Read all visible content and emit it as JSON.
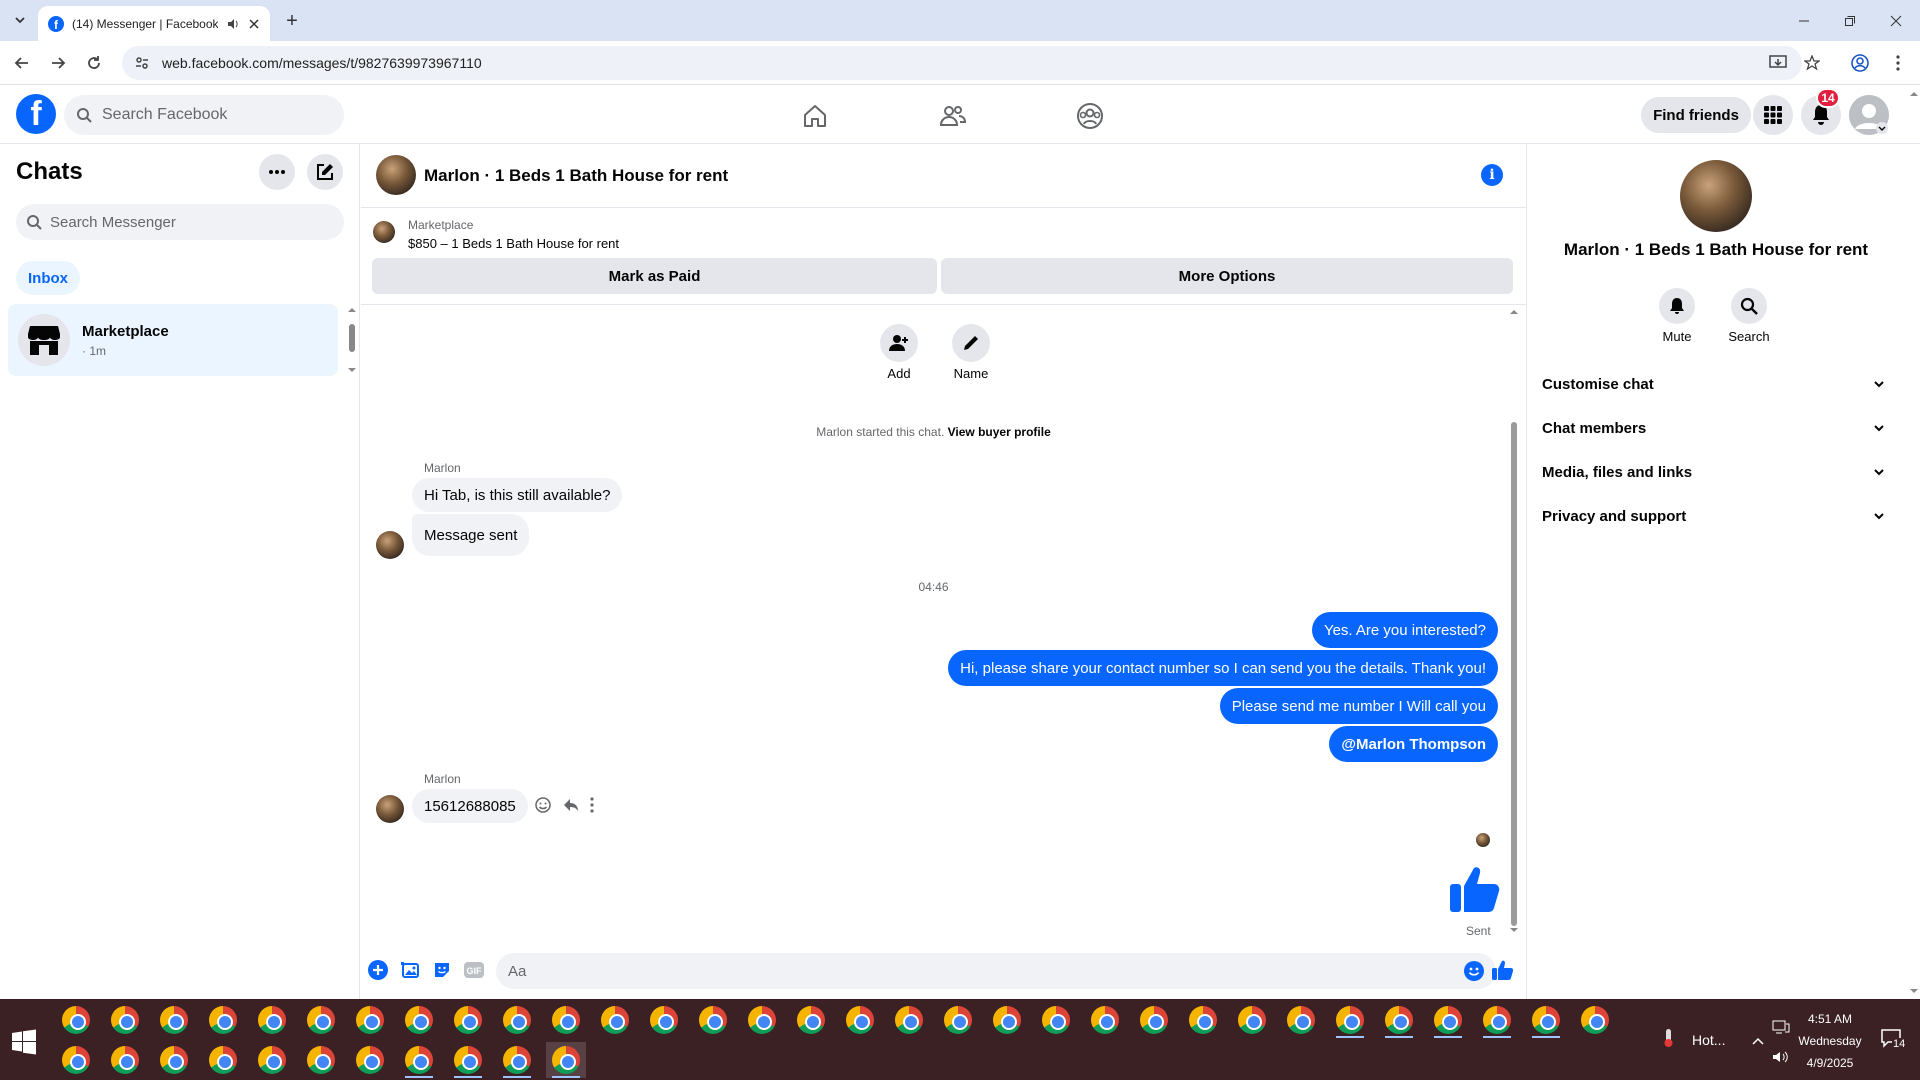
{
  "browser": {
    "tab_title": "(14) Messenger | Facebook",
    "url": "web.facebook.com/messages/t/9827639973967110"
  },
  "fb": {
    "search_placeholder": "Search Facebook",
    "find_friends": "Find friends",
    "notif_count": "14"
  },
  "left": {
    "title": "Chats",
    "search_placeholder": "Search Messenger",
    "inbox_tab": "Inbox",
    "chat_item": {
      "name": "Marketplace",
      "time": "· 1m"
    }
  },
  "conv": {
    "title": "Marlon · 1 Beds 1 Bath House for rent",
    "marketplace_label": "Marketplace",
    "listing": "$850 – 1 Beds 1 Bath House for rent",
    "mark_paid": "Mark as Paid",
    "more_options": "More Options",
    "add_label": "Add",
    "name_label": "Name",
    "started_text": "Marlon started this chat.",
    "view_buyer": "View buyer profile",
    "sender1": "Marlon",
    "in_msg1": "Hi Tab, is this still available?",
    "in_msg2": "Message sent",
    "timestamp": "04:46",
    "out_msgs": [
      "Yes. Are you interested?",
      "Hi, please share your contact number so I can send you the details. Thank you!",
      "Please send me number I Will call you",
      "@Marlon Thompson"
    ],
    "sender2": "Marlon",
    "in_msg3": "15612688085",
    "sent_label": "Sent",
    "composer_placeholder": "Aa"
  },
  "right": {
    "title": "Marlon · 1 Beds 1 Bath House for rent",
    "mute": "Mute",
    "search": "Search",
    "sections": [
      "Customise chat",
      "Chat members",
      "Media, files and links",
      "Privacy and support"
    ]
  },
  "taskbar": {
    "weather": "Hot...",
    "time": "4:51 AM",
    "day": "Wednesday",
    "date": "4/9/2025",
    "notif": "14"
  },
  "colors": {
    "accent": "#0866ff",
    "badge": "#e41e3f"
  }
}
